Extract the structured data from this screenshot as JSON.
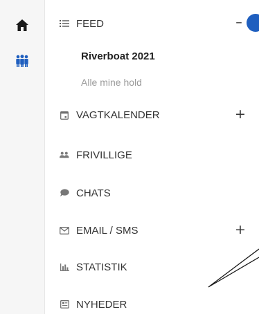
{
  "rail": {
    "items": [
      {
        "icon": "home-icon"
      },
      {
        "icon": "team-icon"
      }
    ]
  },
  "menu": {
    "feed": {
      "label": "FEED",
      "icon": "list-icon",
      "toggle": "–"
    },
    "event_name": "Riverboat 2021",
    "all_teams_link": "Alle mine hold",
    "items": [
      {
        "label": "VAGTKALENDER",
        "icon": "calendar-icon",
        "toggle": "+"
      },
      {
        "label": "FRIVILLIGE",
        "icon": "people-icon"
      },
      {
        "label": "CHATS",
        "icon": "chat-bubble-icon"
      },
      {
        "label": "EMAIL / SMS",
        "icon": "envelope-icon",
        "toggle": "+"
      },
      {
        "label": "STATISTIK",
        "icon": "bar-chart-icon"
      },
      {
        "label": "NYHEDER",
        "icon": "newspaper-icon"
      }
    ]
  },
  "colors": {
    "accent": "#1f5fbf",
    "rail_bg": "#f6f6f6",
    "icon_dark": "#1a1a1a",
    "team_icon": "#1f5fbf"
  }
}
